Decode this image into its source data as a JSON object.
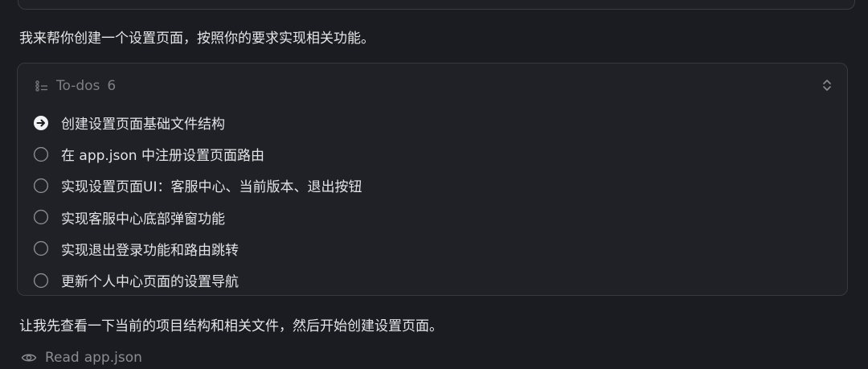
{
  "intro_text": "我来帮你创建一个设置页面，按照你的要求实现相关功能。",
  "todos": {
    "title": "To-dos",
    "count": "6",
    "items": [
      {
        "label": "创建设置页面基础文件结构",
        "status": "in-progress"
      },
      {
        "label": "在 app.json 中注册设置页面路由",
        "status": "pending"
      },
      {
        "label": "实现设置页面UI：客服中心、当前版本、退出按钮",
        "status": "pending"
      },
      {
        "label": "实现客服中心底部弹窗功能",
        "status": "pending"
      },
      {
        "label": "实现退出登录功能和路由跳转",
        "status": "pending"
      },
      {
        "label": "更新个人中心页面的设置导航",
        "status": "pending"
      }
    ]
  },
  "outro_text": "让我先查看一下当前的项目结构和相关文件，然后开始创建设置页面。",
  "tool_action": {
    "verb": "Read",
    "target": "app.json"
  },
  "colors": {
    "background": "#1b1c21",
    "card_background": "#202127",
    "border": "#383940",
    "muted_text": "#7d7e86",
    "primary_text": "#e4e4e6"
  }
}
